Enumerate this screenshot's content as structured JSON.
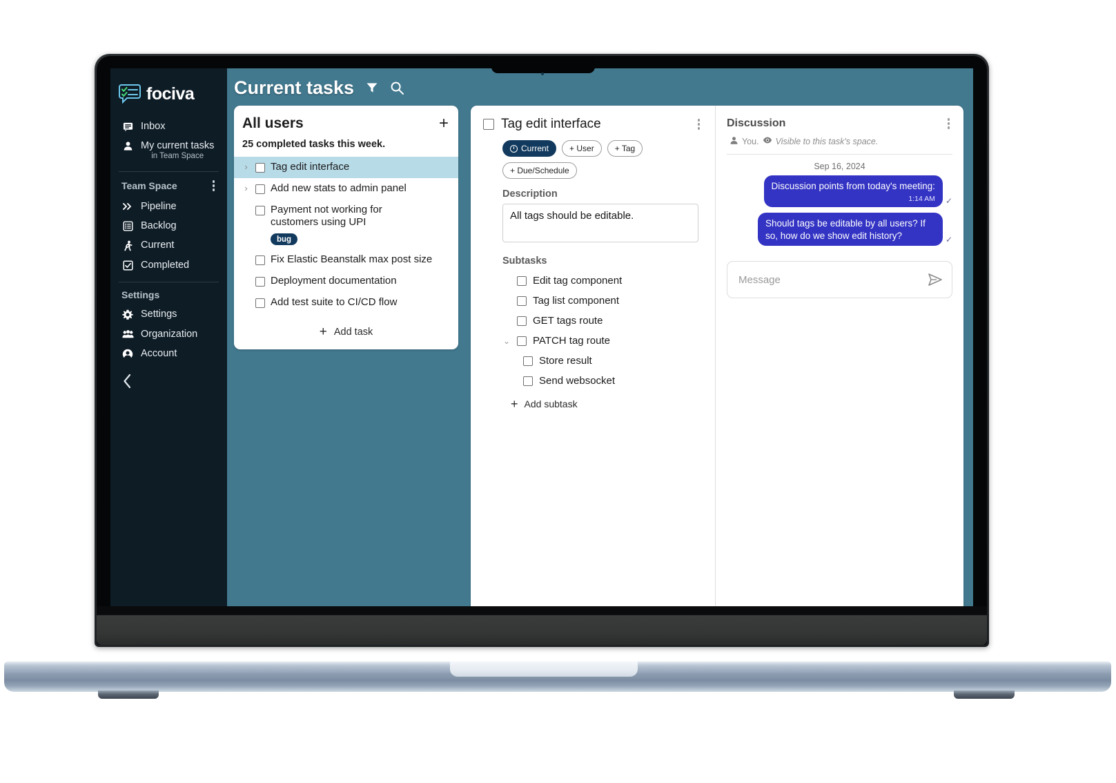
{
  "brand": {
    "name": "fociva",
    "logo_icon": "chat-check-logo-icon"
  },
  "sidebar": {
    "top_items": [
      {
        "label": "Inbox",
        "icon": "inbox-icon"
      },
      {
        "label": "My current tasks",
        "sublabel": "in Team Space",
        "icon": "person-icon"
      }
    ],
    "sections": [
      {
        "title": "Team Space",
        "menu_icon": "kebab-menu-icon",
        "items": [
          {
            "label": "Pipeline",
            "icon": "double-chevron-right-icon"
          },
          {
            "label": "Backlog",
            "icon": "list-box-icon"
          },
          {
            "label": "Current",
            "icon": "running-person-icon"
          },
          {
            "label": "Completed",
            "icon": "checkbox-checked-icon"
          }
        ]
      },
      {
        "title": "Settings",
        "items": [
          {
            "label": "Settings",
            "icon": "gear-icon"
          },
          {
            "label": "Organization",
            "icon": "people-group-icon"
          },
          {
            "label": "Account",
            "icon": "account-circle-icon"
          }
        ]
      }
    ],
    "collapse_icon": "chevron-left-icon"
  },
  "topbar": {
    "title": "Current tasks",
    "filter_icon": "filter-icon",
    "search_icon": "search-icon"
  },
  "task_list": {
    "title": "All users",
    "add_icon": "plus-icon",
    "summary": "25 completed tasks this week.",
    "items": [
      {
        "label": "Tag edit interface",
        "expandable": true,
        "selected": true,
        "checked": false
      },
      {
        "label": "Add new stats to admin panel",
        "expandable": true,
        "selected": false,
        "checked": false
      },
      {
        "label": "Payment not working for customers using UPI",
        "expandable": false,
        "selected": false,
        "checked": false,
        "badge": "bug"
      },
      {
        "label": "Fix Elastic Beanstalk max post size",
        "expandable": false,
        "selected": false,
        "checked": false
      },
      {
        "label": "Deployment documentation",
        "expandable": false,
        "selected": false,
        "checked": false
      },
      {
        "label": "Add test suite to CI/CD flow",
        "expandable": false,
        "selected": false,
        "checked": false
      }
    ],
    "add_task_label": "Add task"
  },
  "detail": {
    "title": "Tag edit interface",
    "checked": false,
    "menu_icon": "kebab-menu-icon",
    "chips": [
      {
        "label": "Current",
        "active": true,
        "icon": "clock-icon"
      },
      {
        "label": "+ User",
        "active": false
      },
      {
        "label": "+ Tag",
        "active": false
      },
      {
        "label": "+ Due/Schedule",
        "active": false
      }
    ],
    "description_label": "Description",
    "description_value": "All tags should be editable.",
    "subtasks_label": "Subtasks",
    "subtasks": [
      {
        "label": "Edit tag component",
        "level": 1,
        "expandable": false,
        "checked": false
      },
      {
        "label": "Tag list component",
        "level": 1,
        "expandable": false,
        "checked": false
      },
      {
        "label": "GET tags route",
        "level": 1,
        "expandable": false,
        "checked": false
      },
      {
        "label": "PATCH tag route",
        "level": 1,
        "expandable": true,
        "checked": false
      },
      {
        "label": "Store result",
        "level": 2,
        "expandable": false,
        "checked": false
      },
      {
        "label": "Send websocket",
        "level": 2,
        "expandable": false,
        "checked": false
      }
    ],
    "add_subtask_label": "Add subtask"
  },
  "discussion": {
    "title": "Discussion",
    "menu_icon": "kebab-menu-icon",
    "author": "You.",
    "author_icon": "person-icon",
    "visibility_icon": "eye-icon",
    "visibility": "Visible to this task's space.",
    "date_divider": "Sep 16, 2024",
    "messages": [
      {
        "text": "Discussion points from today's meeting:",
        "time": "1:14 AM",
        "status_icon": "check-icon"
      },
      {
        "text": "Should tags be editable by all users? If so, how do we show edit history?",
        "time": "",
        "status_icon": "check-icon"
      }
    ],
    "input_placeholder": "Message",
    "send_icon": "send-icon"
  },
  "colors": {
    "sidebar_bg": "#0e1c26",
    "workspace_teal": "#42798f",
    "selected_row": "#b8dbe8",
    "chip_active": "#123a5e",
    "badge_bug": "#123a5e",
    "bubble": "#3333c4"
  }
}
